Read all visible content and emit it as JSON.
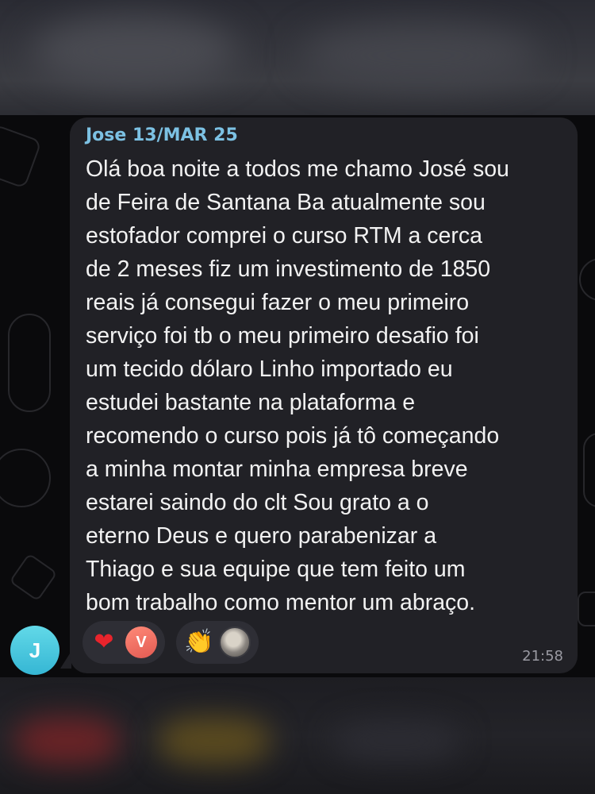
{
  "message": {
    "sender_label": "Jose 13/MAR 25",
    "text": "Olá boa noite a todos me chamo José sou\nde Feira de Santana Ba atualmente sou\nestofador  comprei o curso RTM a cerca\nde 2 meses fiz um investimento de 1850\nreais já consegui fazer o meu primeiro\nserviço foi tb o meu primeiro desafio foi\num tecido dólaro Linho importado eu\nestudei bastante na plataforma e\nrecomendo o curso pois já tô começando\na minha montar minha empresa breve\nestarei saindo do clt    Sou grato a o\neterno Deus e quero parabenizar a\nThiago e sua equipe que tem feito um\nbom trabalho como mentor um abraço.",
    "time": "21:58",
    "sender_avatar_initial": "J",
    "reactions": [
      {
        "emoji": "❤",
        "icon": "heart-icon",
        "reactor_initial": "V",
        "reactor_color": "#e8665b"
      },
      {
        "emoji": "👏",
        "icon": "clapping-hands-icon",
        "reactor_type": "photo"
      }
    ]
  },
  "colors": {
    "bubble": "#212126",
    "sender_name": "#7cc1e3",
    "avatar": "#47c4dc",
    "text": "#f2f2f2",
    "timestamp": "#9a9aa2"
  }
}
